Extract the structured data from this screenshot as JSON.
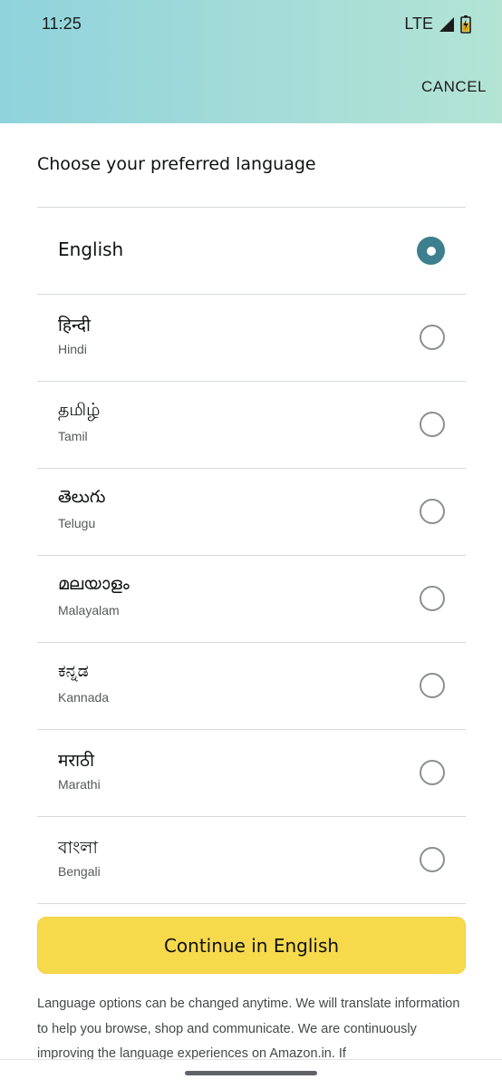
{
  "status_bar": {
    "time": "11:25",
    "network": "LTE",
    "signal_icon": "signal-icon",
    "battery_icon": "battery-icon"
  },
  "header": {
    "cancel_label": "CANCEL",
    "gradient_colors": [
      "#8fd3dd",
      "#b3e4d4"
    ]
  },
  "main": {
    "title": "Choose your preferred language",
    "languages": [
      {
        "native": "English",
        "english": "",
        "selected": true
      },
      {
        "native": "हिन्दी",
        "english": "Hindi",
        "selected": false
      },
      {
        "native": "தமிழ்",
        "english": "Tamil",
        "selected": false
      },
      {
        "native": "తెలుగు",
        "english": "Telugu",
        "selected": false
      },
      {
        "native": "മലയാളം",
        "english": "Malayalam",
        "selected": false
      },
      {
        "native": "ಕನ್ನಡ",
        "english": "Kannada",
        "selected": false
      },
      {
        "native": "मराठी",
        "english": "Marathi",
        "selected": false
      },
      {
        "native": "বাংলা",
        "english": "Bengali",
        "selected": false
      }
    ],
    "continue_label": "Continue in English",
    "footer_text": "Language options can be changed anytime. We will translate information to help you browse, shop and communicate. We are continuously improving the language experiences on Amazon.in. If"
  },
  "colors": {
    "accent_radio": "#3c7f8e",
    "button_yellow": "#f7d94c"
  }
}
